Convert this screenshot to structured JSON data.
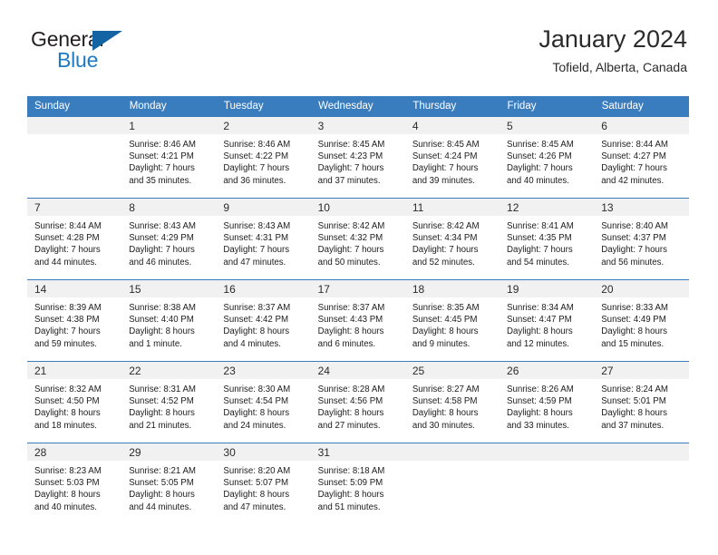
{
  "brand": {
    "name_part1": "General",
    "name_part2": "Blue"
  },
  "header": {
    "title": "January 2024",
    "subtitle": "Tofield, Alberta, Canada"
  },
  "colors": {
    "header_blue": "#3a7dbf",
    "logo_blue": "#1f7ac4",
    "daynum_bg": "#f1f1f1"
  },
  "weekdays": [
    "Sunday",
    "Monday",
    "Tuesday",
    "Wednesday",
    "Thursday",
    "Friday",
    "Saturday"
  ],
  "weeks": [
    [
      {
        "day": "",
        "blank": true,
        "sunrise": "",
        "sunset": "",
        "daylight1": "",
        "daylight2": ""
      },
      {
        "day": "1",
        "sunrise": "Sunrise: 8:46 AM",
        "sunset": "Sunset: 4:21 PM",
        "daylight1": "Daylight: 7 hours",
        "daylight2": "and 35 minutes."
      },
      {
        "day": "2",
        "sunrise": "Sunrise: 8:46 AM",
        "sunset": "Sunset: 4:22 PM",
        "daylight1": "Daylight: 7 hours",
        "daylight2": "and 36 minutes."
      },
      {
        "day": "3",
        "sunrise": "Sunrise: 8:45 AM",
        "sunset": "Sunset: 4:23 PM",
        "daylight1": "Daylight: 7 hours",
        "daylight2": "and 37 minutes."
      },
      {
        "day": "4",
        "sunrise": "Sunrise: 8:45 AM",
        "sunset": "Sunset: 4:24 PM",
        "daylight1": "Daylight: 7 hours",
        "daylight2": "and 39 minutes."
      },
      {
        "day": "5",
        "sunrise": "Sunrise: 8:45 AM",
        "sunset": "Sunset: 4:26 PM",
        "daylight1": "Daylight: 7 hours",
        "daylight2": "and 40 minutes."
      },
      {
        "day": "6",
        "sunrise": "Sunrise: 8:44 AM",
        "sunset": "Sunset: 4:27 PM",
        "daylight1": "Daylight: 7 hours",
        "daylight2": "and 42 minutes."
      }
    ],
    [
      {
        "day": "7",
        "sunrise": "Sunrise: 8:44 AM",
        "sunset": "Sunset: 4:28 PM",
        "daylight1": "Daylight: 7 hours",
        "daylight2": "and 44 minutes."
      },
      {
        "day": "8",
        "sunrise": "Sunrise: 8:43 AM",
        "sunset": "Sunset: 4:29 PM",
        "daylight1": "Daylight: 7 hours",
        "daylight2": "and 46 minutes."
      },
      {
        "day": "9",
        "sunrise": "Sunrise: 8:43 AM",
        "sunset": "Sunset: 4:31 PM",
        "daylight1": "Daylight: 7 hours",
        "daylight2": "and 47 minutes."
      },
      {
        "day": "10",
        "sunrise": "Sunrise: 8:42 AM",
        "sunset": "Sunset: 4:32 PM",
        "daylight1": "Daylight: 7 hours",
        "daylight2": "and 50 minutes."
      },
      {
        "day": "11",
        "sunrise": "Sunrise: 8:42 AM",
        "sunset": "Sunset: 4:34 PM",
        "daylight1": "Daylight: 7 hours",
        "daylight2": "and 52 minutes."
      },
      {
        "day": "12",
        "sunrise": "Sunrise: 8:41 AM",
        "sunset": "Sunset: 4:35 PM",
        "daylight1": "Daylight: 7 hours",
        "daylight2": "and 54 minutes."
      },
      {
        "day": "13",
        "sunrise": "Sunrise: 8:40 AM",
        "sunset": "Sunset: 4:37 PM",
        "daylight1": "Daylight: 7 hours",
        "daylight2": "and 56 minutes."
      }
    ],
    [
      {
        "day": "14",
        "sunrise": "Sunrise: 8:39 AM",
        "sunset": "Sunset: 4:38 PM",
        "daylight1": "Daylight: 7 hours",
        "daylight2": "and 59 minutes."
      },
      {
        "day": "15",
        "sunrise": "Sunrise: 8:38 AM",
        "sunset": "Sunset: 4:40 PM",
        "daylight1": "Daylight: 8 hours",
        "daylight2": "and 1 minute."
      },
      {
        "day": "16",
        "sunrise": "Sunrise: 8:37 AM",
        "sunset": "Sunset: 4:42 PM",
        "daylight1": "Daylight: 8 hours",
        "daylight2": "and 4 minutes."
      },
      {
        "day": "17",
        "sunrise": "Sunrise: 8:37 AM",
        "sunset": "Sunset: 4:43 PM",
        "daylight1": "Daylight: 8 hours",
        "daylight2": "and 6 minutes."
      },
      {
        "day": "18",
        "sunrise": "Sunrise: 8:35 AM",
        "sunset": "Sunset: 4:45 PM",
        "daylight1": "Daylight: 8 hours",
        "daylight2": "and 9 minutes."
      },
      {
        "day": "19",
        "sunrise": "Sunrise: 8:34 AM",
        "sunset": "Sunset: 4:47 PM",
        "daylight1": "Daylight: 8 hours",
        "daylight2": "and 12 minutes."
      },
      {
        "day": "20",
        "sunrise": "Sunrise: 8:33 AM",
        "sunset": "Sunset: 4:49 PM",
        "daylight1": "Daylight: 8 hours",
        "daylight2": "and 15 minutes."
      }
    ],
    [
      {
        "day": "21",
        "sunrise": "Sunrise: 8:32 AM",
        "sunset": "Sunset: 4:50 PM",
        "daylight1": "Daylight: 8 hours",
        "daylight2": "and 18 minutes."
      },
      {
        "day": "22",
        "sunrise": "Sunrise: 8:31 AM",
        "sunset": "Sunset: 4:52 PM",
        "daylight1": "Daylight: 8 hours",
        "daylight2": "and 21 minutes."
      },
      {
        "day": "23",
        "sunrise": "Sunrise: 8:30 AM",
        "sunset": "Sunset: 4:54 PM",
        "daylight1": "Daylight: 8 hours",
        "daylight2": "and 24 minutes."
      },
      {
        "day": "24",
        "sunrise": "Sunrise: 8:28 AM",
        "sunset": "Sunset: 4:56 PM",
        "daylight1": "Daylight: 8 hours",
        "daylight2": "and 27 minutes."
      },
      {
        "day": "25",
        "sunrise": "Sunrise: 8:27 AM",
        "sunset": "Sunset: 4:58 PM",
        "daylight1": "Daylight: 8 hours",
        "daylight2": "and 30 minutes."
      },
      {
        "day": "26",
        "sunrise": "Sunrise: 8:26 AM",
        "sunset": "Sunset: 4:59 PM",
        "daylight1": "Daylight: 8 hours",
        "daylight2": "and 33 minutes."
      },
      {
        "day": "27",
        "sunrise": "Sunrise: 8:24 AM",
        "sunset": "Sunset: 5:01 PM",
        "daylight1": "Daylight: 8 hours",
        "daylight2": "and 37 minutes."
      }
    ],
    [
      {
        "day": "28",
        "sunrise": "Sunrise: 8:23 AM",
        "sunset": "Sunset: 5:03 PM",
        "daylight1": "Daylight: 8 hours",
        "daylight2": "and 40 minutes."
      },
      {
        "day": "29",
        "sunrise": "Sunrise: 8:21 AM",
        "sunset": "Sunset: 5:05 PM",
        "daylight1": "Daylight: 8 hours",
        "daylight2": "and 44 minutes."
      },
      {
        "day": "30",
        "sunrise": "Sunrise: 8:20 AM",
        "sunset": "Sunset: 5:07 PM",
        "daylight1": "Daylight: 8 hours",
        "daylight2": "and 47 minutes."
      },
      {
        "day": "31",
        "sunrise": "Sunrise: 8:18 AM",
        "sunset": "Sunset: 5:09 PM",
        "daylight1": "Daylight: 8 hours",
        "daylight2": "and 51 minutes."
      },
      {
        "day": "",
        "blank": true,
        "sunrise": "",
        "sunset": "",
        "daylight1": "",
        "daylight2": ""
      },
      {
        "day": "",
        "blank": true,
        "sunrise": "",
        "sunset": "",
        "daylight1": "",
        "daylight2": ""
      },
      {
        "day": "",
        "blank": true,
        "sunrise": "",
        "sunset": "",
        "daylight1": "",
        "daylight2": ""
      }
    ]
  ]
}
